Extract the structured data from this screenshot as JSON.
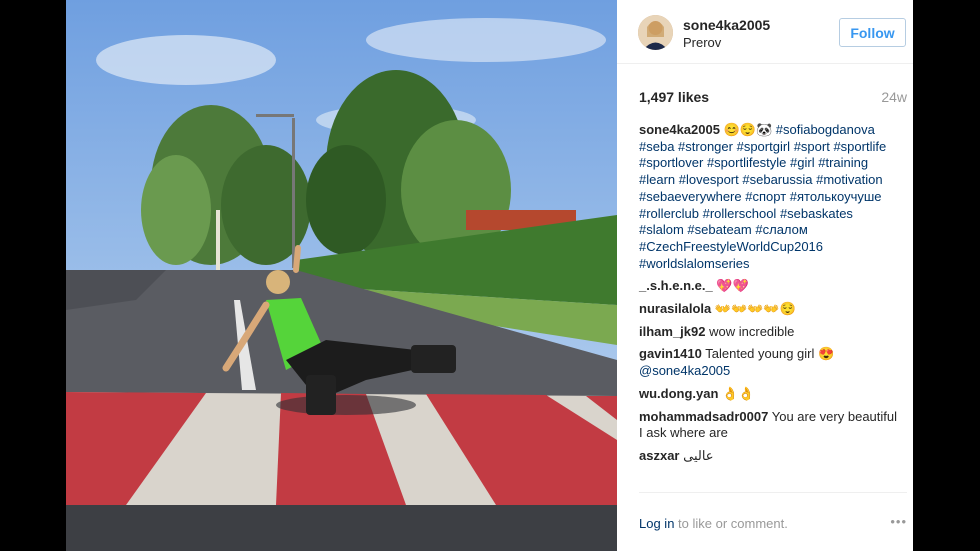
{
  "post": {
    "username": "sone4ka2005",
    "location": "Prerov",
    "follow_label": "Follow",
    "likes": "1,497 likes",
    "age": "24w"
  },
  "comments": [
    {
      "user": "sone4ka2005",
      "pre": "😊😌🐼",
      "tags": [
        "#sofiabogdanova",
        "#seba",
        "#stronger",
        "#sportgirl",
        "#sport",
        "#sportlife",
        "#sportlover",
        "#sportlifestyle",
        "#girl",
        "#training",
        "#learn",
        "#lovesport",
        "#sebarussia",
        "#motivation",
        "#sebaeverywhere",
        "#спорт",
        "#ятолькоучуше",
        "#rollerclub",
        "#rollerschool",
        "#sebaskates",
        "#slalom",
        "#sebateam",
        "#слалом",
        "#CzechFreestyleWorldCup2016",
        "#worldslalomseries"
      ]
    },
    {
      "user": "_.s.h.e.n.e._",
      "text": "💖💖"
    },
    {
      "user": "nurasilalola",
      "text": "👐👐👐👐😌"
    },
    {
      "user": "ilham_jk92",
      "text": "wow incredible"
    },
    {
      "user": "gavin1410",
      "text": "Talented young girl 😍",
      "mention": "@sone4ka2005"
    },
    {
      "user": "wu.dong.yan",
      "text": "👌👌"
    },
    {
      "user": "mohammadsadr0007",
      "text": "You are very beautiful I ask where are"
    },
    {
      "user": "aszxar",
      "text": "عالیی"
    }
  ],
  "footer": {
    "login": "Log in",
    "rest": " to like or comment.",
    "more": "•••"
  }
}
